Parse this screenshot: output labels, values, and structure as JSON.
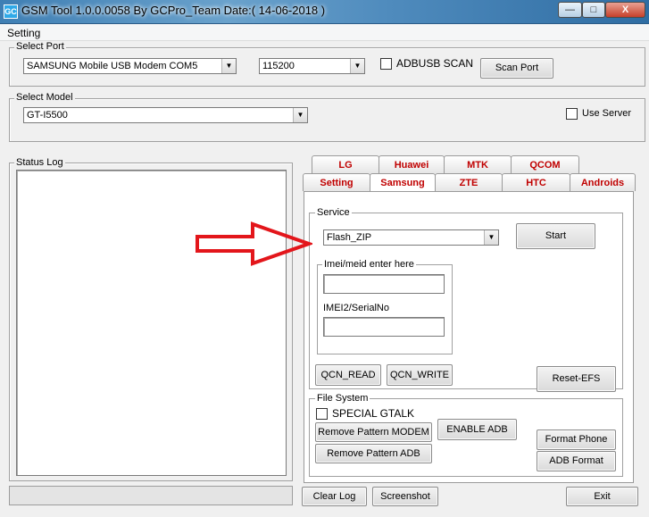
{
  "window": {
    "title": "GSM Tool 1.0.0.0058 By GCPro_Team  Date:( 14-06-2018 )",
    "app_icon_text": "GC",
    "min_glyph": "—",
    "max_glyph": "□",
    "close_glyph": "X"
  },
  "menu": {
    "items": [
      "Setting"
    ]
  },
  "select_port": {
    "legend": "Select Port",
    "port_value": "SAMSUNG Mobile USB Modem COM5",
    "baud_value": "115200",
    "adbusb_label": "ADBUSB SCAN",
    "adbusb_checked": false,
    "scan_button": "Scan Port"
  },
  "select_model": {
    "legend": "Select Model",
    "model_value": "GT-I5500",
    "use_server_label": "Use Server",
    "use_server_checked": false
  },
  "status_log": {
    "legend": "Status Log"
  },
  "tabs": {
    "row1": [
      "LG",
      "Huawei",
      "MTK",
      "QCOM"
    ],
    "row2": [
      "Setting",
      "Samsung",
      "ZTE",
      "HTC",
      "Androids"
    ],
    "active": "Samsung"
  },
  "service": {
    "legend": "Service",
    "selected": "Flash_ZIP",
    "start_button": "Start",
    "imei_group_legend": "Imei/meid enter here",
    "imei2_label": "IMEI2/SerialNo",
    "qcn_read": "QCN_READ",
    "qcn_write": "QCN_WRITE",
    "reset_efs": "Reset-EFS"
  },
  "file_system": {
    "legend": "File System",
    "special_gtalk": "SPECIAL GTALK",
    "special_gtalk_checked": false,
    "remove_pattern_modem": "Remove Pattern MODEM",
    "remove_pattern_adb": "Remove Pattern ADB",
    "enable_adb": "ENABLE ADB",
    "format_phone": "Format Phone",
    "adb_format": "ADB Format"
  },
  "bottom": {
    "clear_log": "Clear Log",
    "screenshot": "Screenshot",
    "exit": "Exit"
  },
  "colors": {
    "tab_text": "#c00000",
    "annotation_arrow": "#e3161b",
    "titlebar": "#4f8bbd"
  }
}
